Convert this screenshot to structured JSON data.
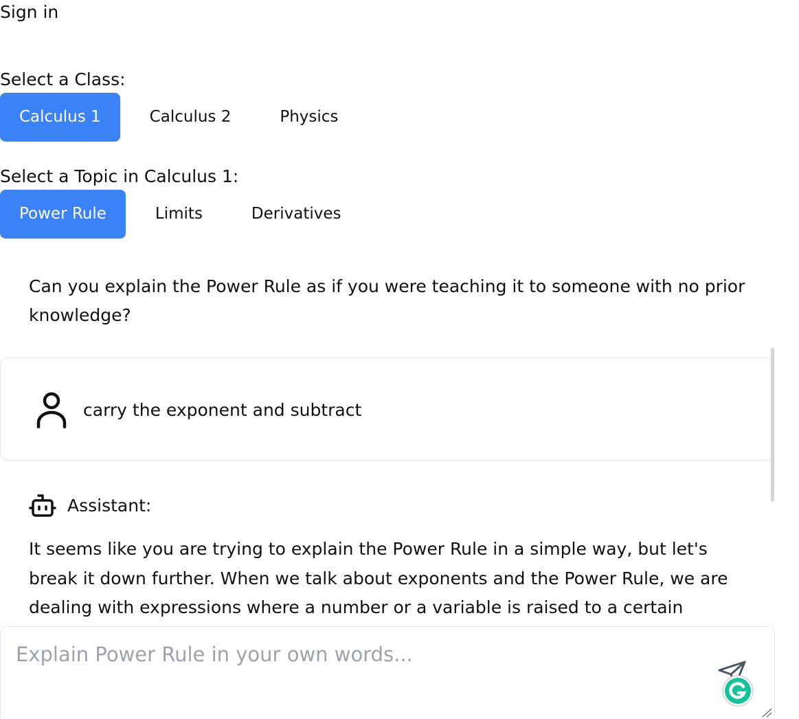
{
  "header": {
    "signin_label": "Sign in"
  },
  "class_selector": {
    "label": "Select a Class:",
    "options": [
      "Calculus 1",
      "Calculus 2",
      "Physics"
    ],
    "selected": "Calculus 1"
  },
  "topic_selector": {
    "label": "Select a Topic in Calculus 1:",
    "options": [
      "Power Rule",
      "Limits",
      "Derivatives"
    ],
    "selected": "Power Rule"
  },
  "prompt": {
    "text": "Can you explain the Power Rule as if you were teaching it to someone with no prior knowledge?"
  },
  "conversation": {
    "user_message": "carry the exponent and subtract",
    "assistant_label": "Assistant:",
    "assistant_message": "It seems like you are trying to explain the Power Rule in a simple way, but let's break it down further. When we talk about exponents and the Power Rule, we are dealing with expressions where a number or a variable is raised to a certain power."
  },
  "composer": {
    "placeholder": "Explain Power Rule in your own words...",
    "value": ""
  },
  "colors": {
    "accent": "#3b82f6",
    "grammarly": "#15c39a"
  },
  "icons": {
    "user": "user-icon",
    "assistant": "bot-icon",
    "send": "send-icon",
    "grammarly": "grammarly-icon"
  }
}
